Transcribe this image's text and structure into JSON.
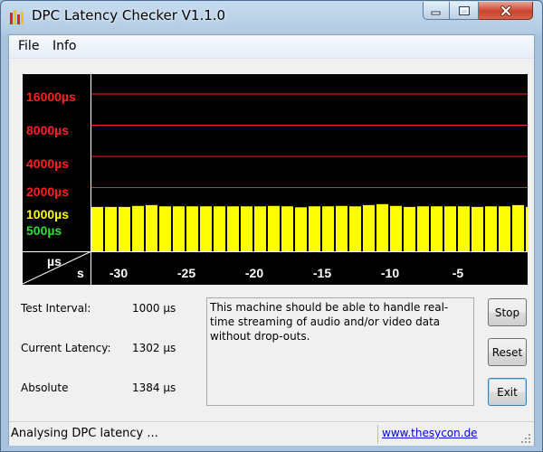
{
  "window": {
    "title": "DPC Latency Checker V1.1.0"
  },
  "menu": {
    "file_label": "File",
    "info_label": "Info"
  },
  "chart_data": {
    "type": "bar",
    "background": "#000000",
    "bar_color": "#ffff00",
    "gridline_color": "#ff2020",
    "y_labels": [
      {
        "label": "16000µs",
        "color": "#ff2020"
      },
      {
        "label": "8000µs",
        "color": "#ff2020"
      },
      {
        "label": "4000µs",
        "color": "#ff2020"
      },
      {
        "label": "2000µs",
        "color": "#ff2020"
      },
      {
        "label": "1000µs",
        "color": "#ffff00"
      },
      {
        "label": "500µs",
        "color": "#33dd33"
      }
    ],
    "y_unit_label": "µs",
    "x_unit_label": "s",
    "x_ticks": [
      "-30",
      "-25",
      "-20",
      "-15",
      "-10",
      "-5"
    ],
    "scale": "log2",
    "x": [
      -32,
      -31,
      -30,
      -29,
      -28,
      -27,
      -26,
      -25,
      -24,
      -23,
      -22,
      -21,
      -20,
      -19,
      -18,
      -17,
      -16,
      -15,
      -14,
      -13,
      -12,
      -11,
      -10,
      -9,
      -8,
      -7,
      -6,
      -5,
      -4,
      -3,
      -2,
      -1
    ],
    "values": [
      1302,
      1302,
      1302,
      1330,
      1355,
      1318,
      1318,
      1318,
      1318,
      1318,
      1318,
      1318,
      1318,
      1330,
      1318,
      1290,
      1318,
      1318,
      1330,
      1318,
      1355,
      1384,
      1330,
      1302,
      1318,
      1318,
      1318,
      1318,
      1302,
      1318,
      1318,
      1355,
      1302,
      1250,
      1302
    ]
  },
  "info": {
    "test_interval_label": "Test Interval:",
    "test_interval_value": "1000 µs",
    "current_latency_label": "Current Latency:",
    "current_latency_value": "1302 µs",
    "absolute_label": "Absolute",
    "absolute_value": "1384 µs"
  },
  "message": "This machine should be able to handle real-time streaming of audio and/or video data without drop-outs.",
  "buttons": {
    "stop": "Stop",
    "reset": "Reset",
    "exit": "Exit"
  },
  "status": {
    "text": "Analysing DPC latency ...",
    "link": "www.thesycon.de"
  }
}
